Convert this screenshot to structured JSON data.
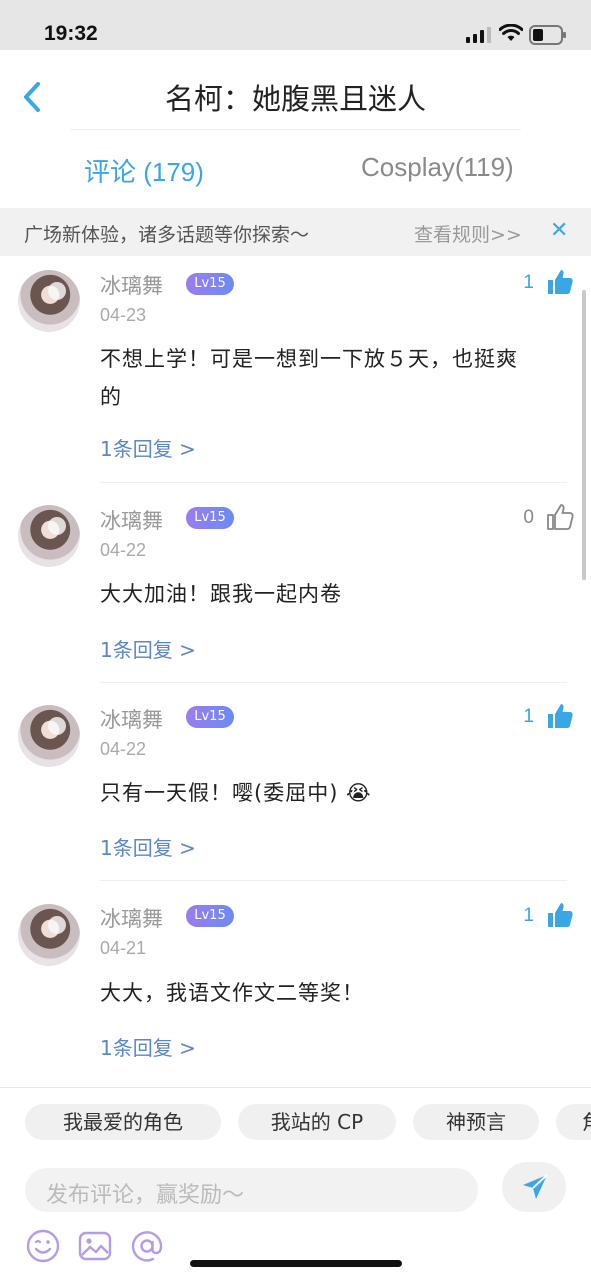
{
  "status_bar": {
    "time": "19:32"
  },
  "header": {
    "title": "名柯：她腹黑且迷人",
    "back_icon": "chevron-left-icon"
  },
  "tabs": [
    {
      "label": "评论 (179)",
      "active": true
    },
    {
      "label": "Cosplay(119)",
      "active": false
    }
  ],
  "notice": {
    "text": "广场新体验，诸多话题等你探索～",
    "link": "查看规则>>",
    "close_icon": "close-icon"
  },
  "comments": [
    {
      "user": "冰璃舞",
      "level": "Lv15",
      "date": "04-23",
      "likes": "1",
      "liked": true,
      "body_line1": "不想上学！可是一想到一下放５天，也挺爽",
      "body_line2": "的",
      "replies": "1条回复 >"
    },
    {
      "user": "冰璃舞",
      "level": "Lv15",
      "date": "04-22",
      "likes": "0",
      "liked": false,
      "body_line1": "大大加油！跟我一起内卷",
      "body_line2": "",
      "replies": "1条回复 >"
    },
    {
      "user": "冰璃舞",
      "level": "Lv15",
      "date": "04-22",
      "likes": "1",
      "liked": true,
      "body_line1": "只有一天假！嘤(委屈中) 😭",
      "body_line2": "",
      "replies": "1条回复 >"
    },
    {
      "user": "冰璃舞",
      "level": "Lv15",
      "date": "04-21",
      "likes": "1",
      "liked": true,
      "body_line1": "大大，我语文作文二等奖！",
      "body_line2": "",
      "replies": "1条回复 >"
    }
  ],
  "topic_chips": [
    "我最爱的角色",
    "我站的 CP",
    "神预言",
    "角"
  ],
  "composer": {
    "placeholder": "发布评论，赢奖励～",
    "send_icon": "send-icon"
  },
  "tools": [
    "emoji-icon",
    "image-icon",
    "mention-icon"
  ],
  "colors": {
    "accent": "#3aa6e6",
    "reply_link": "#5b86c7",
    "level_badge": "#8a82f0"
  }
}
